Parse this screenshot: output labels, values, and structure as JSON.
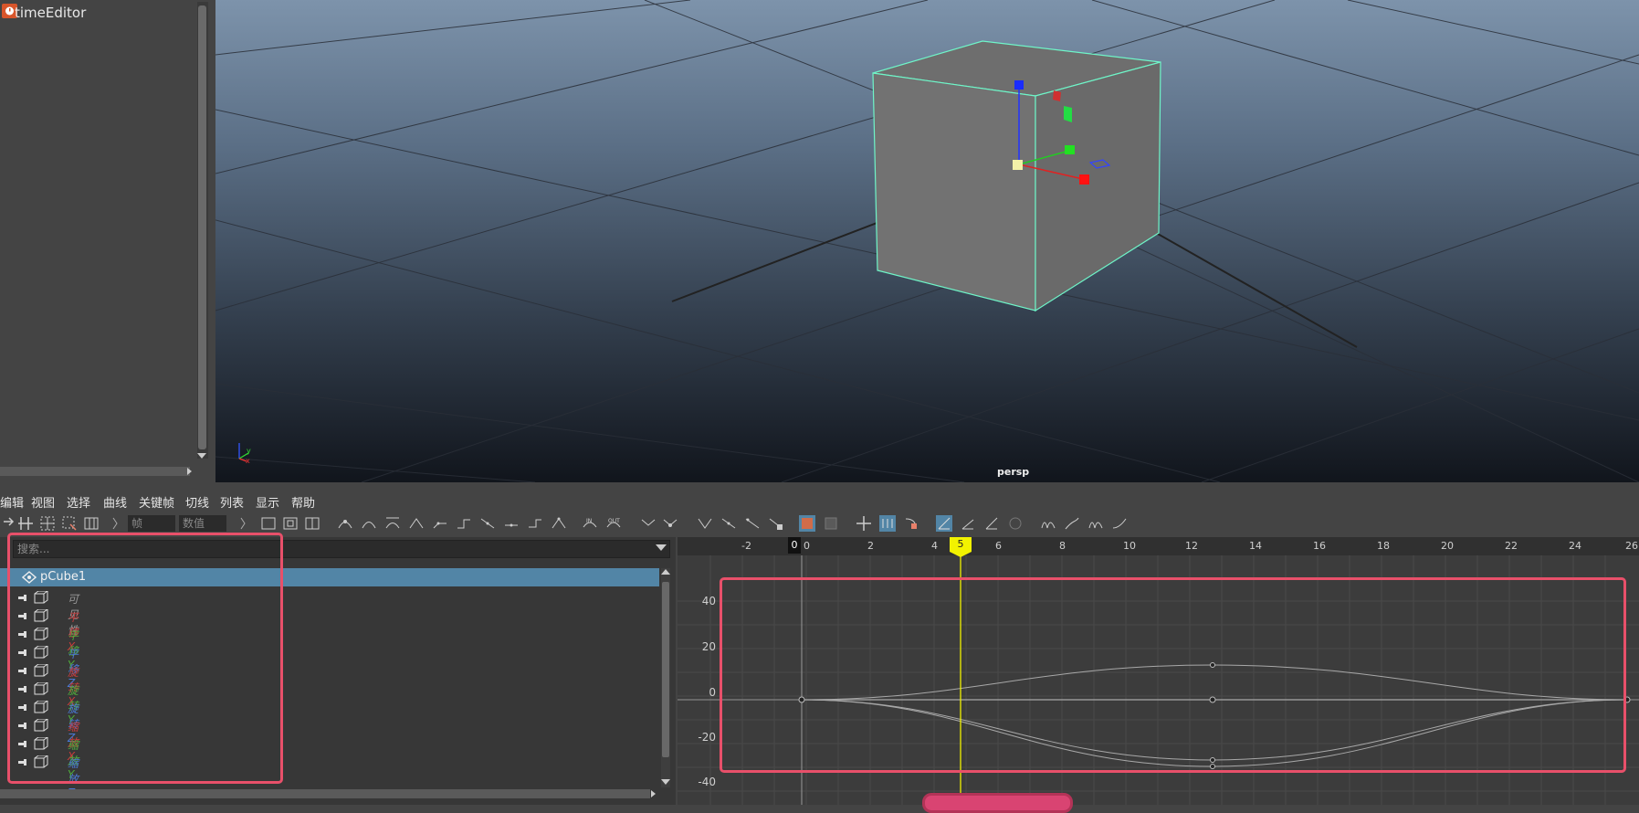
{
  "window": {
    "title": "timeEditor"
  },
  "viewport": {
    "camera_label": "persp"
  },
  "menubar": {
    "items": [
      "编辑",
      "视图",
      "选择",
      "曲线",
      "关键帧",
      "切线",
      "列表",
      "显示",
      "帮助"
    ]
  },
  "toolbar": {
    "frame_placeholder": "帧",
    "value_placeholder": "数值"
  },
  "outliner": {
    "search_placeholder": "搜索...",
    "root": "pCube1",
    "channels": [
      {
        "label": "可见性",
        "color": "#9a9a9a"
      },
      {
        "label": "平移 X",
        "color": "#c83c3c"
      },
      {
        "label": "平移 Y",
        "color": "#4faa3c"
      },
      {
        "label": "平移 Z",
        "color": "#4a78d4"
      },
      {
        "label": "旋转 X",
        "color": "#c83c3c"
      },
      {
        "label": "旋转 Y",
        "color": "#4faa3c"
      },
      {
        "label": "旋转 Z",
        "color": "#4a78d4"
      },
      {
        "label": "缩放 X",
        "color": "#c83c3c"
      },
      {
        "label": "缩放 Y",
        "color": "#4faa3c"
      },
      {
        "label": "缩放 Z",
        "color": "#4a78d4"
      }
    ]
  },
  "graph": {
    "ruler_ticks": [
      "-2",
      "0",
      "2",
      "4",
      "6",
      "8",
      "10",
      "12",
      "14",
      "16",
      "18",
      "20",
      "22",
      "24",
      "26"
    ],
    "start_marker": "0",
    "current_frame": "5",
    "y_ticks": [
      "40",
      "20",
      "0",
      "-20",
      "-40"
    ]
  },
  "colors": {
    "accent_highlight": "#e8506a",
    "selection": "#5285a6",
    "current_time": "#f2f200"
  }
}
